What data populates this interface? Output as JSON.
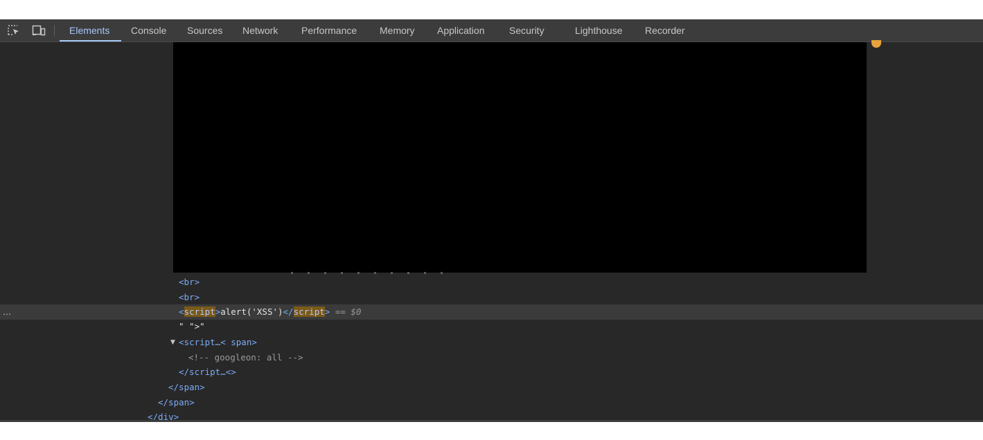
{
  "toolbar": {
    "inspect_icon": "inspect-element-icon",
    "device_icon": "device-toolbar-icon",
    "tabs": [
      {
        "label": "Elements"
      },
      {
        "label": "Console"
      },
      {
        "label": "Sources"
      },
      {
        "label": "Network"
      },
      {
        "label": "Performance"
      },
      {
        "label": "Memory"
      },
      {
        "label": "Application"
      },
      {
        "label": "Security"
      },
      {
        "label": "Lighthouse"
      },
      {
        "label": "Recorder"
      }
    ],
    "active_tab": "Elements"
  },
  "colors": {
    "accent": "#a8c7fa",
    "panel_bg": "#282828",
    "toolbar_bg": "#3c3c3c",
    "highlight": "#7a5a17"
  },
  "dom_tree": {
    "br1": "<br>",
    "br2": "<br>",
    "selected_open_lt": "<",
    "selected_open_name": "script",
    "selected_open_gt": ">",
    "selected_text": "alert('XSS')",
    "selected_close_lt": "</",
    "selected_close_name": "script",
    "selected_close_gt": ">",
    "selected_eq": "==",
    "selected_dollar": "$0",
    "ellipsis": "…",
    "text_node": "\" \">\"",
    "expanded_triangle": "▼",
    "script_span_open": "<script…< span>",
    "comment": "<!-- googleon: all -->",
    "script_close": "</script…<>",
    "span_close_1": "</span>",
    "span_close_2": "</span>",
    "div_close": "</div>"
  }
}
